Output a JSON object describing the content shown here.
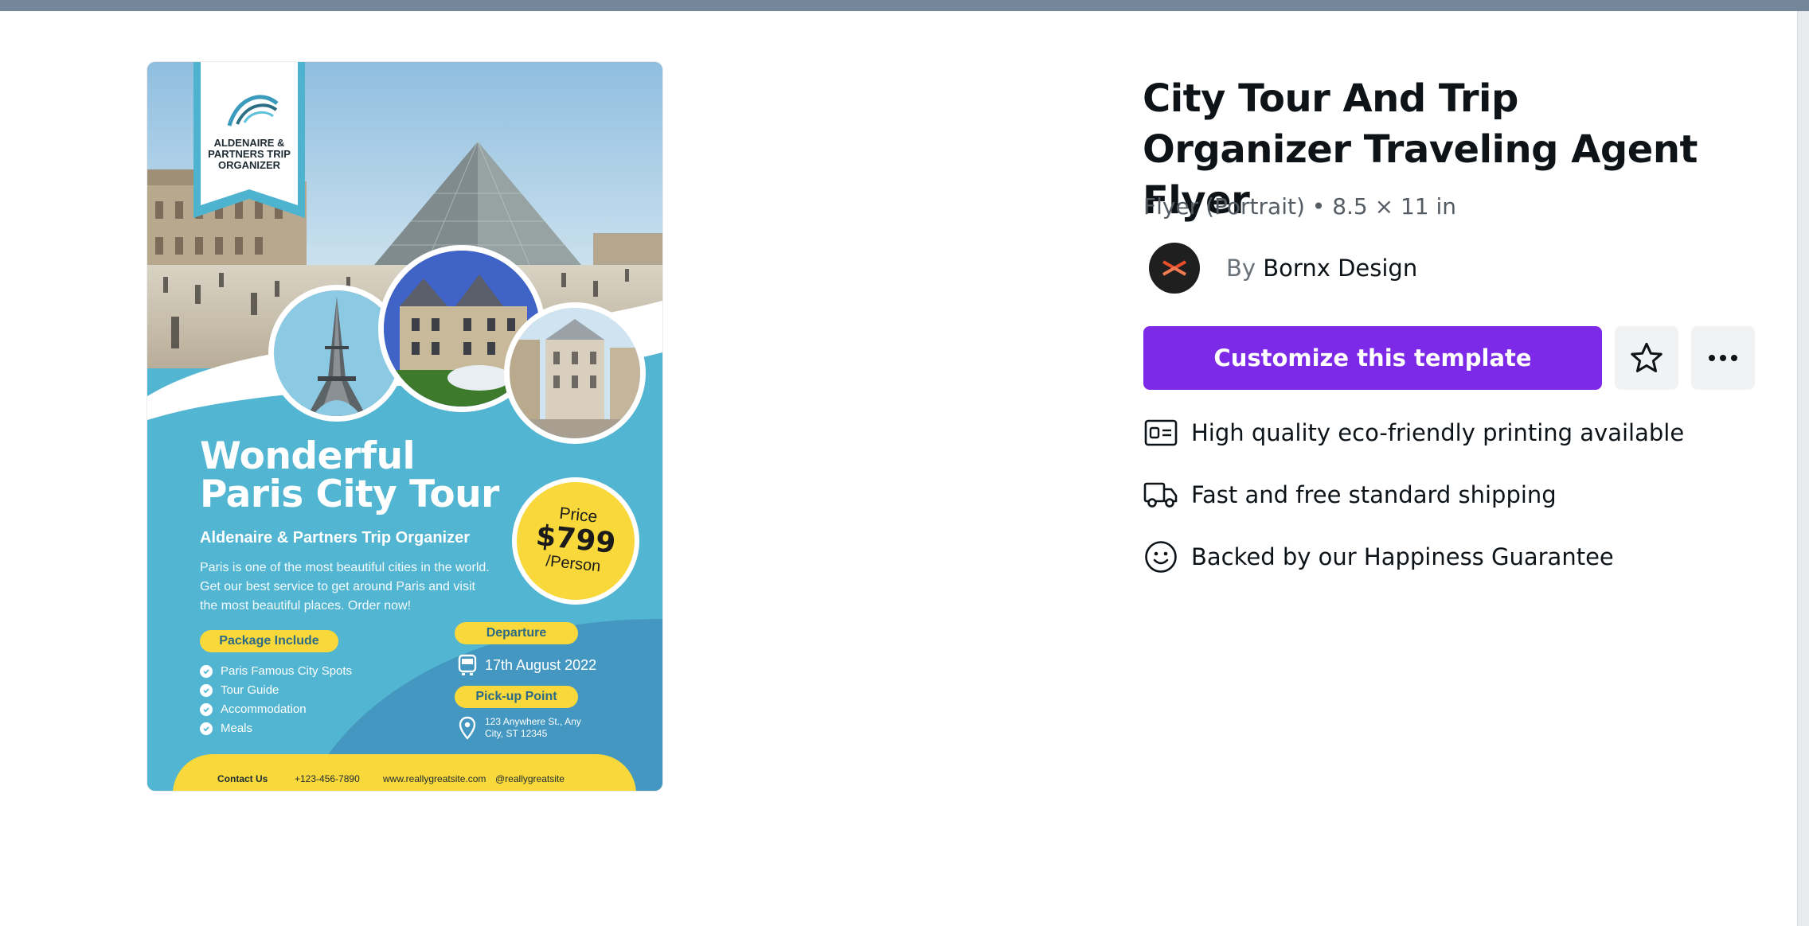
{
  "flyer": {
    "brand": "ALDENAIRE &\nPARTNERS TRIP\nORGANIZER",
    "headline": "Wonderful\nParis City Tour",
    "subtitle": "Aldenaire & Partners Trip Organizer",
    "description": "Paris is one of the most beautiful cities in the world. Get our best service to get around Paris and visit the most beautiful places. Order now!",
    "price_label": "Price",
    "price_value": "$799",
    "price_unit": "/Person",
    "package_label": "Package Include",
    "package_items": [
      "Paris Famous City Spots",
      "Tour Guide",
      "Accommodation",
      "Meals"
    ],
    "departure_label": "Departure",
    "departure_date": "17th August 2022",
    "pickup_label": "Pick-up Point",
    "pickup_address": "123 Anywhere St., Any\nCity, ST 12345",
    "contact_label": "Contact Us",
    "phone": "+123-456-7890",
    "website": "www.reallygreatsite.com",
    "social": "@reallygreatsite"
  },
  "template": {
    "title": "City Tour And Trip Organizer Traveling Agent Flyer",
    "meta": "Flyer (Portrait) • 8.5 × 11 in",
    "by_label": "By",
    "author": "Bornx Design",
    "customize_label": "Customize this template"
  },
  "features": [
    {
      "icon": "print-card-icon",
      "text": "High quality eco-friendly printing available"
    },
    {
      "icon": "truck-icon",
      "text": "Fast and free standard shipping"
    },
    {
      "icon": "smiley-icon",
      "text": "Backed by our Happiness Guarantee"
    }
  ],
  "colors": {
    "accent": "#7d2ae8",
    "flyer_blue": "#52b5d1",
    "flyer_yellow": "#f8d83a"
  }
}
